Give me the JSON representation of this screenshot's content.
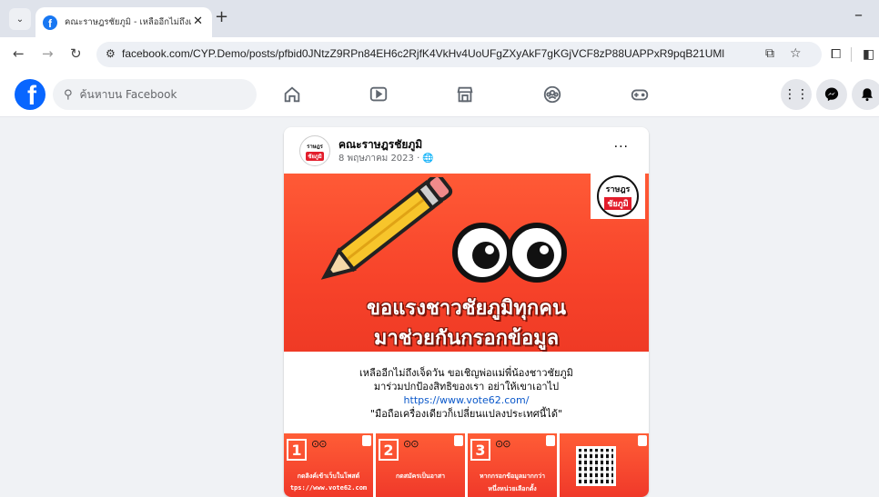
{
  "browser": {
    "tab_title": "คณะราษฎรชัยภูมิ - เหลืออีกไม่ถึงเจ็ด",
    "url": "facebook.com/CYP.Demo/posts/pfbid0JNtzZ9RPn84EH6c2RjfK4VkHv4UoUFgZXyAkF7gKGjVCF8zP88UAPPxR9pqB21UMl"
  },
  "facebook": {
    "search_placeholder": "ค้นหาบน Facebook"
  },
  "post": {
    "page_name": "คณะราษฎรชัยภูมิ",
    "date": "8 พฤษภาคม 2023 · 🌐",
    "avatar_text": [
      "ราษฎร",
      "ชัยภูมิ"
    ],
    "banner_line1": "ขอแรงชาวชัยภูมิทุกคน",
    "banner_line2": "มาช่วยกันกรอกข้อมูล",
    "text_line1": "เหลืออีกไม่ถึงเจ็ดวัน ขอเชิญพ่อแม่พี่น้องชาวชัยภูมิ",
    "text_line2": "มาร่วมปกป้องสิทธิของเรา อย่าให้เขาเอาไป",
    "link": "https://www.vote62.com/",
    "text_line3": "\"มือถือเครื่องเดียวก็เปลี่ยนแปลงประเทศนี้ได้\"",
    "thumbnails": [
      {
        "num": "1",
        "caption": "กดลิงค์เข้าเว็บในโพสต์",
        "caption2": "tps://www.vote62.com"
      },
      {
        "num": "2",
        "caption": "กดสมัครเป็นอาสา",
        "caption2": ""
      },
      {
        "num": "3",
        "caption": "หากกรอกข้อมูลมากกว่า",
        "caption2": "หนึ่งหน่วยเลือกตั้ง"
      },
      {
        "num": "",
        "caption": "",
        "caption2": ""
      }
    ]
  }
}
